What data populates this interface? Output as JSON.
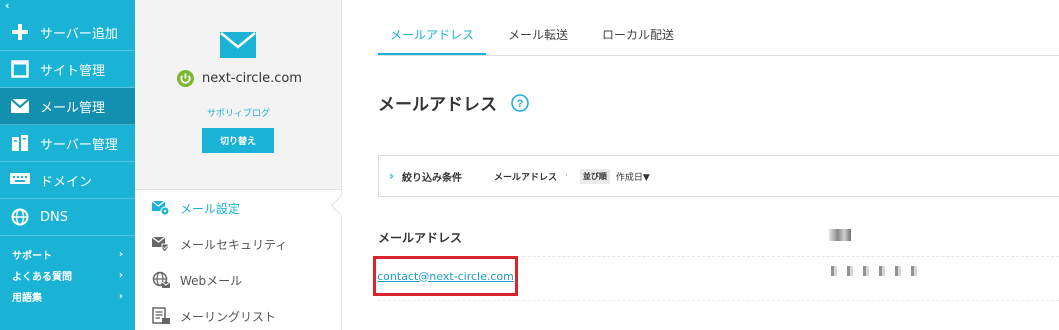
{
  "nav": {
    "collapse_label": "‹",
    "items": [
      {
        "label": "サーバー追加",
        "icon": "plus-icon"
      },
      {
        "label": "サイト管理",
        "icon": "window-icon"
      },
      {
        "label": "メール管理",
        "icon": "mail-icon"
      },
      {
        "label": "サーバー管理",
        "icon": "server-icon"
      },
      {
        "label": "ドメイン",
        "icon": "keyboard-icon"
      },
      {
        "label": "DNS",
        "icon": "globe-icon"
      }
    ],
    "sub_items": [
      {
        "label": "サポート",
        "chevron": "›"
      },
      {
        "label": "よくある質問",
        "chevron": "›"
      },
      {
        "label": "用語集",
        "chevron": "›"
      }
    ]
  },
  "domain_panel": {
    "domain": "next-circle.com",
    "site_name": "サポリィブログ",
    "switch_label": "切り替え",
    "menu": [
      {
        "label": "メール設定",
        "icon": "mail-settings-icon"
      },
      {
        "label": "メールセキュリティ",
        "icon": "mail-shield-icon"
      },
      {
        "label": "Webメール",
        "icon": "globe-mail-icon"
      },
      {
        "label": "メーリングリスト",
        "icon": "list-icon"
      }
    ]
  },
  "main": {
    "tabs": [
      "メールアドレス",
      "メール転送",
      "ローカル配送"
    ],
    "title": "メールアドレス",
    "filter": {
      "chevron": "›",
      "label": "絞り込み条件",
      "field": "メールアドレス",
      "dot": "·",
      "sort_chip": "並び順",
      "sort_value": "作成日▼"
    },
    "column_header": "メールアドレス",
    "rows": [
      {
        "email": "contact@next-circle.com"
      }
    ]
  },
  "colors": {
    "accent": "#1ab3d6",
    "accent_dark": "#138fb0",
    "highlight": "#d9232d",
    "power": "#7cb82f"
  }
}
